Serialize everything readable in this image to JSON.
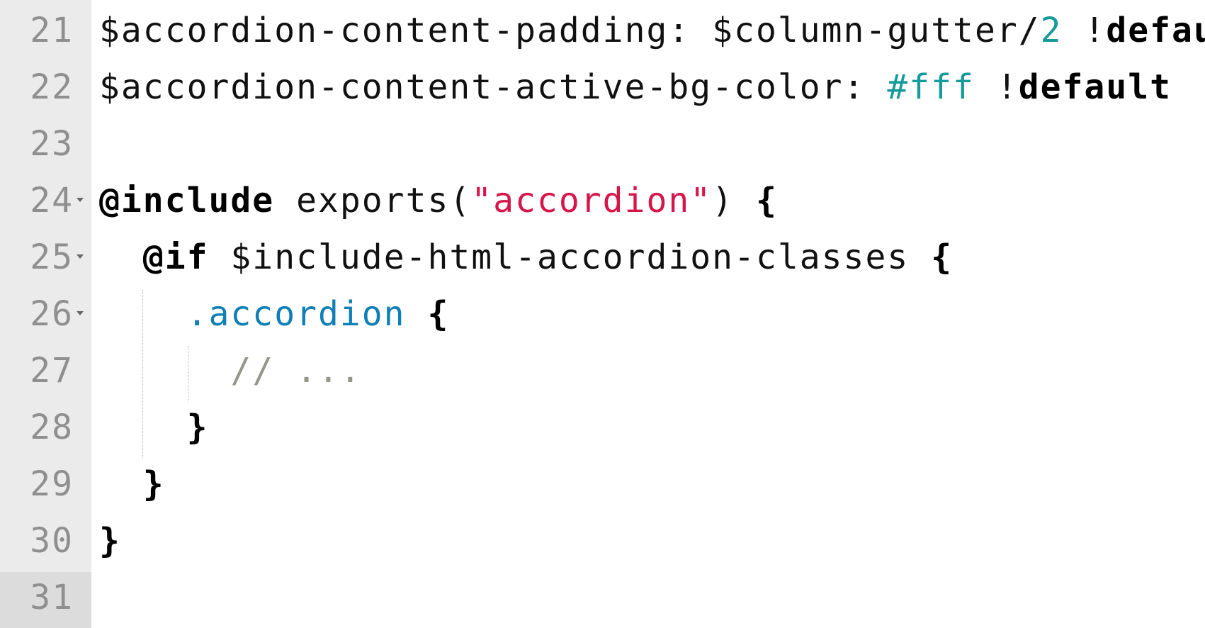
{
  "editor": {
    "lines": [
      {
        "number": "21",
        "foldable": false,
        "tokens": [
          {
            "text": "$accordion-content-padding: $column-gutter/",
            "type": "plain"
          },
          {
            "text": "2",
            "type": "num"
          },
          {
            "text": " !",
            "type": "plain"
          },
          {
            "text": "default",
            "type": "kw"
          }
        ]
      },
      {
        "number": "22",
        "foldable": false,
        "tokens": [
          {
            "text": "$accordion-content-active-bg-color: ",
            "type": "plain"
          },
          {
            "text": "#fff",
            "type": "num"
          },
          {
            "text": " !",
            "type": "plain"
          },
          {
            "text": "default",
            "type": "kw"
          }
        ]
      },
      {
        "number": "23",
        "foldable": false,
        "tokens": []
      },
      {
        "number": "24",
        "foldable": true,
        "tokens": [
          {
            "text": "@include",
            "type": "kw"
          },
          {
            "text": " exports(",
            "type": "plain"
          },
          {
            "text": "\"accordion\"",
            "type": "str"
          },
          {
            "text": ") ",
            "type": "plain"
          },
          {
            "text": "{",
            "type": "kw"
          }
        ]
      },
      {
        "number": "25",
        "foldable": true,
        "tokens": [
          {
            "text": "  ",
            "type": "plain"
          },
          {
            "text": "@if",
            "type": "kw"
          },
          {
            "text": " $include-html-accordion-classes ",
            "type": "plain"
          },
          {
            "text": "{",
            "type": "kw"
          }
        ]
      },
      {
        "number": "26",
        "foldable": true,
        "tokens": [
          {
            "text": "    ",
            "type": "plain"
          },
          {
            "text": ".accordion",
            "type": "cls"
          },
          {
            "text": " ",
            "type": "plain"
          },
          {
            "text": "{",
            "type": "kw"
          }
        ]
      },
      {
        "number": "27",
        "foldable": false,
        "tokens": [
          {
            "text": "      ",
            "type": "plain"
          },
          {
            "text": "// ...",
            "type": "cmt"
          }
        ]
      },
      {
        "number": "28",
        "foldable": false,
        "tokens": [
          {
            "text": "    ",
            "type": "plain"
          },
          {
            "text": "}",
            "type": "kw"
          }
        ]
      },
      {
        "number": "29",
        "foldable": false,
        "tokens": [
          {
            "text": "  ",
            "type": "plain"
          },
          {
            "text": "}",
            "type": "kw"
          }
        ]
      },
      {
        "number": "30",
        "foldable": false,
        "tokens": [
          {
            "text": "}",
            "type": "kw"
          }
        ]
      },
      {
        "number": "31",
        "foldable": false,
        "active": true,
        "tokens": []
      }
    ]
  },
  "colors": {
    "gutter_bg": "#ebebeb",
    "active_gutter_bg": "#dcdcdc",
    "line_number": "#8f8f8f",
    "number_literal": "#169a9a",
    "string_literal": "#d6154a",
    "class_selector": "#0f7fb5",
    "comment": "#969688"
  }
}
